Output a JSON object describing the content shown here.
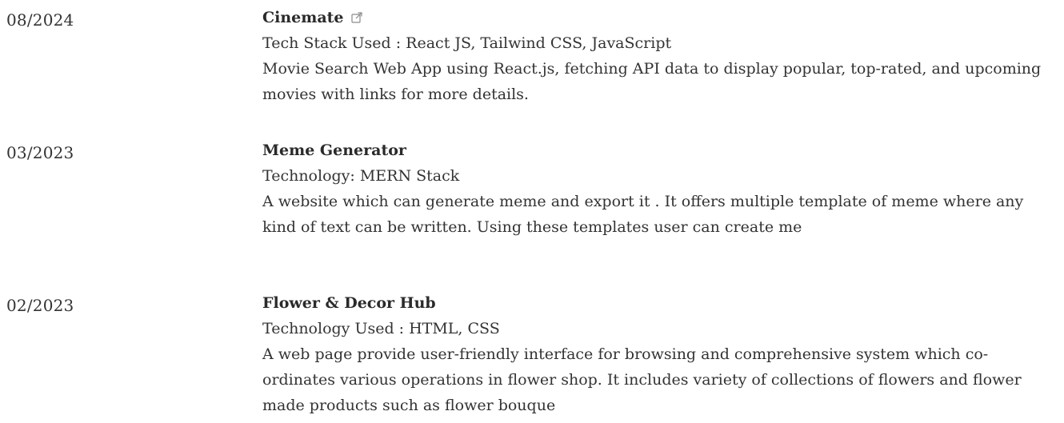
{
  "projects": [
    {
      "date": "08/2024",
      "title": "Cinemate",
      "has_link": true,
      "link_icon": "external-link-icon",
      "stack": "Tech Stack Used : React JS, Tailwind CSS, JavaScript",
      "description": "Movie Search Web App using React.js, fetching API data to display popular, top-rated, and upcoming movies with links for more details."
    },
    {
      "date": "03/2023",
      "title": "Meme Generator",
      "has_link": false,
      "stack": "Technology: MERN Stack",
      "description": "A website which can generate meme and export it . It offers multiple template of meme where any kind of text can be written. Using these templates user can create me"
    },
    {
      "date": "02/2023",
      "title": "Flower & Decor Hub",
      "has_link": false,
      "stack": "Technology Used : HTML, CSS",
      "description": "A web page provide user-friendly interface for browsing and comprehensive system which co-ordinates various operations in flower shop. It includes variety of collections of flowers and flower made products such as flower bouque"
    }
  ],
  "colors": {
    "text": "#333333",
    "title": "#2a2a2a",
    "icon": "#8a8a8a",
    "background": "#ffffff"
  }
}
